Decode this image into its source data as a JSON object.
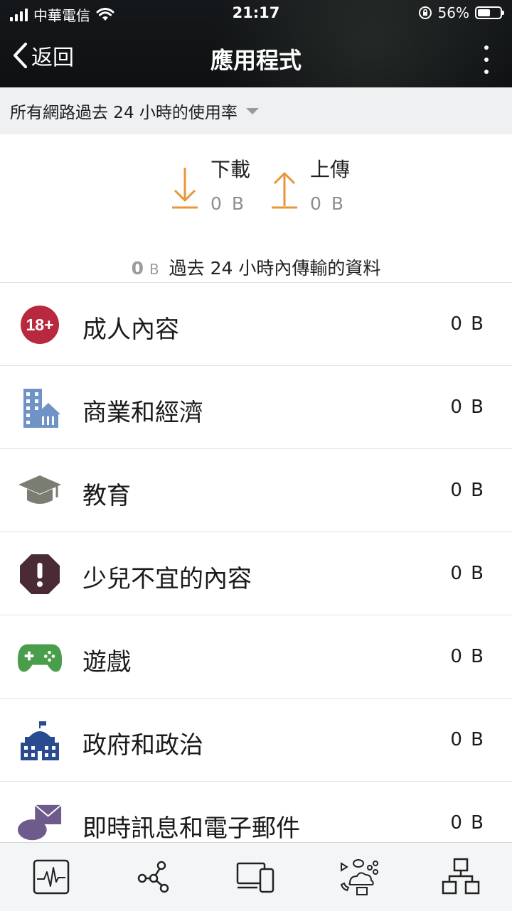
{
  "status_bar": {
    "carrier": "中華電信",
    "time": "21:17",
    "battery_percent": "56%",
    "battery_level": 0.56
  },
  "nav": {
    "back_label": "返回",
    "title": "應用程式"
  },
  "filter": {
    "label": "所有網路過去 24 小時的使用率"
  },
  "summary": {
    "download_label": "下載",
    "download_value": "0 B",
    "upload_label": "上傳",
    "upload_value": "0 B",
    "total_value": "0",
    "total_unit": "B",
    "total_label": "過去 24 小時內傳輸的資料"
  },
  "categories": [
    {
      "label": "成人內容",
      "value": "0 B",
      "icon": "adult-18-icon"
    },
    {
      "label": "商業和經濟",
      "value": "0 B",
      "icon": "business-building-icon"
    },
    {
      "label": "教育",
      "value": "0 B",
      "icon": "graduation-cap-icon"
    },
    {
      "label": "少兒不宜的內容",
      "value": "0 B",
      "icon": "warning-octagon-icon"
    },
    {
      "label": "遊戲",
      "value": "0 B",
      "icon": "gamepad-icon"
    },
    {
      "label": "政府和政治",
      "value": "0 B",
      "icon": "government-building-icon"
    },
    {
      "label": "即時訊息和電子郵件",
      "value": "0 B",
      "icon": "chat-email-icon"
    }
  ],
  "icons_text": {
    "adult": "18+"
  },
  "colors": {
    "accent_orange": "#e8963a",
    "adult_red": "#b8283f",
    "business_blue": "#6f93c6",
    "education_gray": "#7a7d71",
    "mature_dark": "#4a2a35",
    "games_green": "#4a9d4a",
    "government_navy": "#2b4b91",
    "messaging_purple": "#6f5a8c"
  },
  "tabs": [
    {
      "name": "activity-tab",
      "icon": "activity-monitor-icon"
    },
    {
      "name": "network-tab",
      "icon": "share-nodes-icon"
    },
    {
      "name": "devices-tab",
      "icon": "devices-icon"
    },
    {
      "name": "apps-tab",
      "icon": "apps-cloud-icon"
    },
    {
      "name": "topology-tab",
      "icon": "topology-icon"
    }
  ]
}
